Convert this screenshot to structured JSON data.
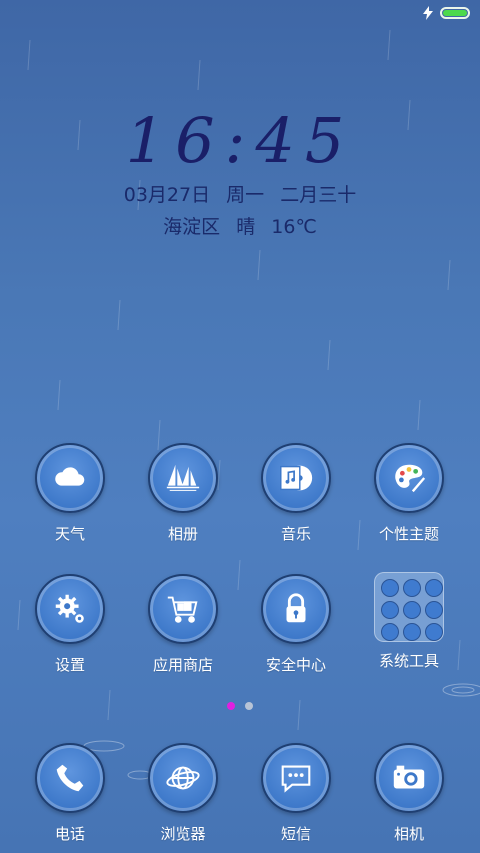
{
  "status_bar": {
    "battery_level": 1.0,
    "charging": true,
    "battery_color": "#4cd94c"
  },
  "lockscreen": {
    "time": "16:45",
    "date": "03月27日",
    "weekday": "周一",
    "lunar": "二月三十",
    "location": "海淀区",
    "condition": "晴",
    "temperature": "16℃"
  },
  "apps": [
    {
      "label": "天气",
      "icon": "cloud-icon"
    },
    {
      "label": "相册",
      "icon": "sailboat-icon"
    },
    {
      "label": "音乐",
      "icon": "music-disc-icon"
    },
    {
      "label": "个性主题",
      "icon": "palette-icon"
    },
    {
      "label": "设置",
      "icon": "gear-icon"
    },
    {
      "label": "应用商店",
      "icon": "cart-icon"
    },
    {
      "label": "安全中心",
      "icon": "lock-icon"
    },
    {
      "label": "系统工具",
      "icon": "folder-icon"
    }
  ],
  "pager": {
    "active_color": "#e020e0",
    "inactive_color": "#b8c4d6",
    "current_page": 1,
    "total_pages": 2
  },
  "dock": [
    {
      "label": "电话",
      "icon": "phone-icon"
    },
    {
      "label": "浏览器",
      "icon": "globe-icon"
    },
    {
      "label": "短信",
      "icon": "message-icon"
    },
    {
      "label": "相机",
      "icon": "camera-icon"
    }
  ]
}
